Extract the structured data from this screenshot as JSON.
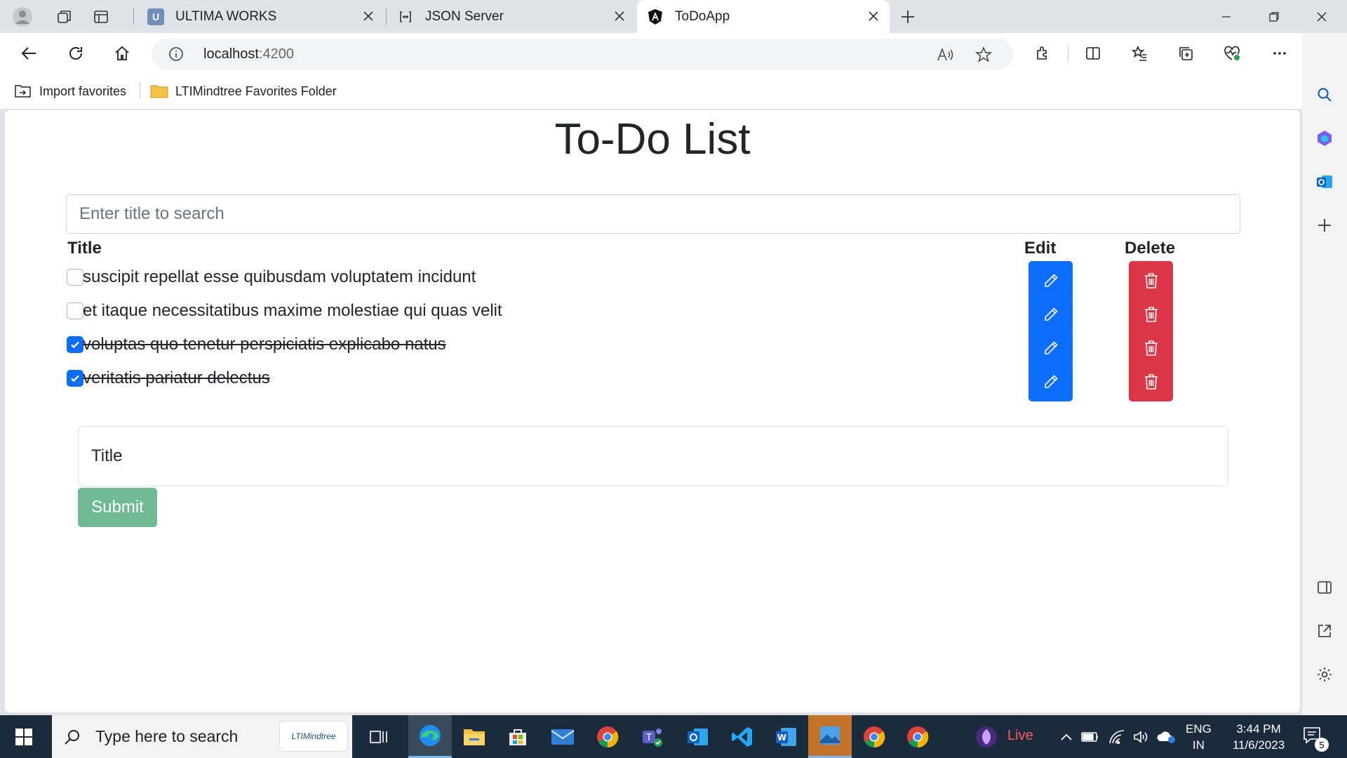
{
  "browser": {
    "tabs": [
      {
        "label": "ULTIMA WORKS",
        "icon": "ultima-favicon"
      },
      {
        "label": "JSON Server",
        "icon": "json-server-favicon"
      },
      {
        "label": "ToDoApp",
        "icon": "angular-favicon",
        "active": true
      }
    ],
    "address": {
      "host": "localhost",
      "port": ":4200"
    },
    "favorites": [
      {
        "label": "Import favorites",
        "icon": "import-favorites-icon"
      },
      {
        "label": "LTIMindtree Favorites Folder",
        "icon": "folder-icon"
      }
    ]
  },
  "app": {
    "title": "To-Do List",
    "search_placeholder": "Enter title to search",
    "columns": {
      "title": "Title",
      "edit": "Edit",
      "delete": "Delete"
    },
    "todos": [
      {
        "title": "suscipit repellat esse quibusdam voluptatem incidunt",
        "completed": false
      },
      {
        "title": "et itaque necessitatibus maxime molestiae qui quas velit",
        "completed": false
      },
      {
        "title": "voluptas quo tenetur perspiciatis explicabo natus",
        "completed": true
      },
      {
        "title": "veritatis pariatur delectus",
        "completed": true
      }
    ],
    "new_title_placeholder": "Title",
    "submit_label": "Submit",
    "colors": {
      "edit": "#0d6efd",
      "delete": "#dc3545",
      "submit": "#6fba94",
      "checked": "#0d6efd"
    }
  },
  "taskbar": {
    "search_text": "Type here to search",
    "search_brand": "LTIMindtree",
    "live_label": "Live",
    "language": {
      "line1": "ENG",
      "line2": "IN"
    },
    "clock": {
      "time": "3:44 PM",
      "date": "11/6/2023"
    },
    "notifications": "5"
  }
}
